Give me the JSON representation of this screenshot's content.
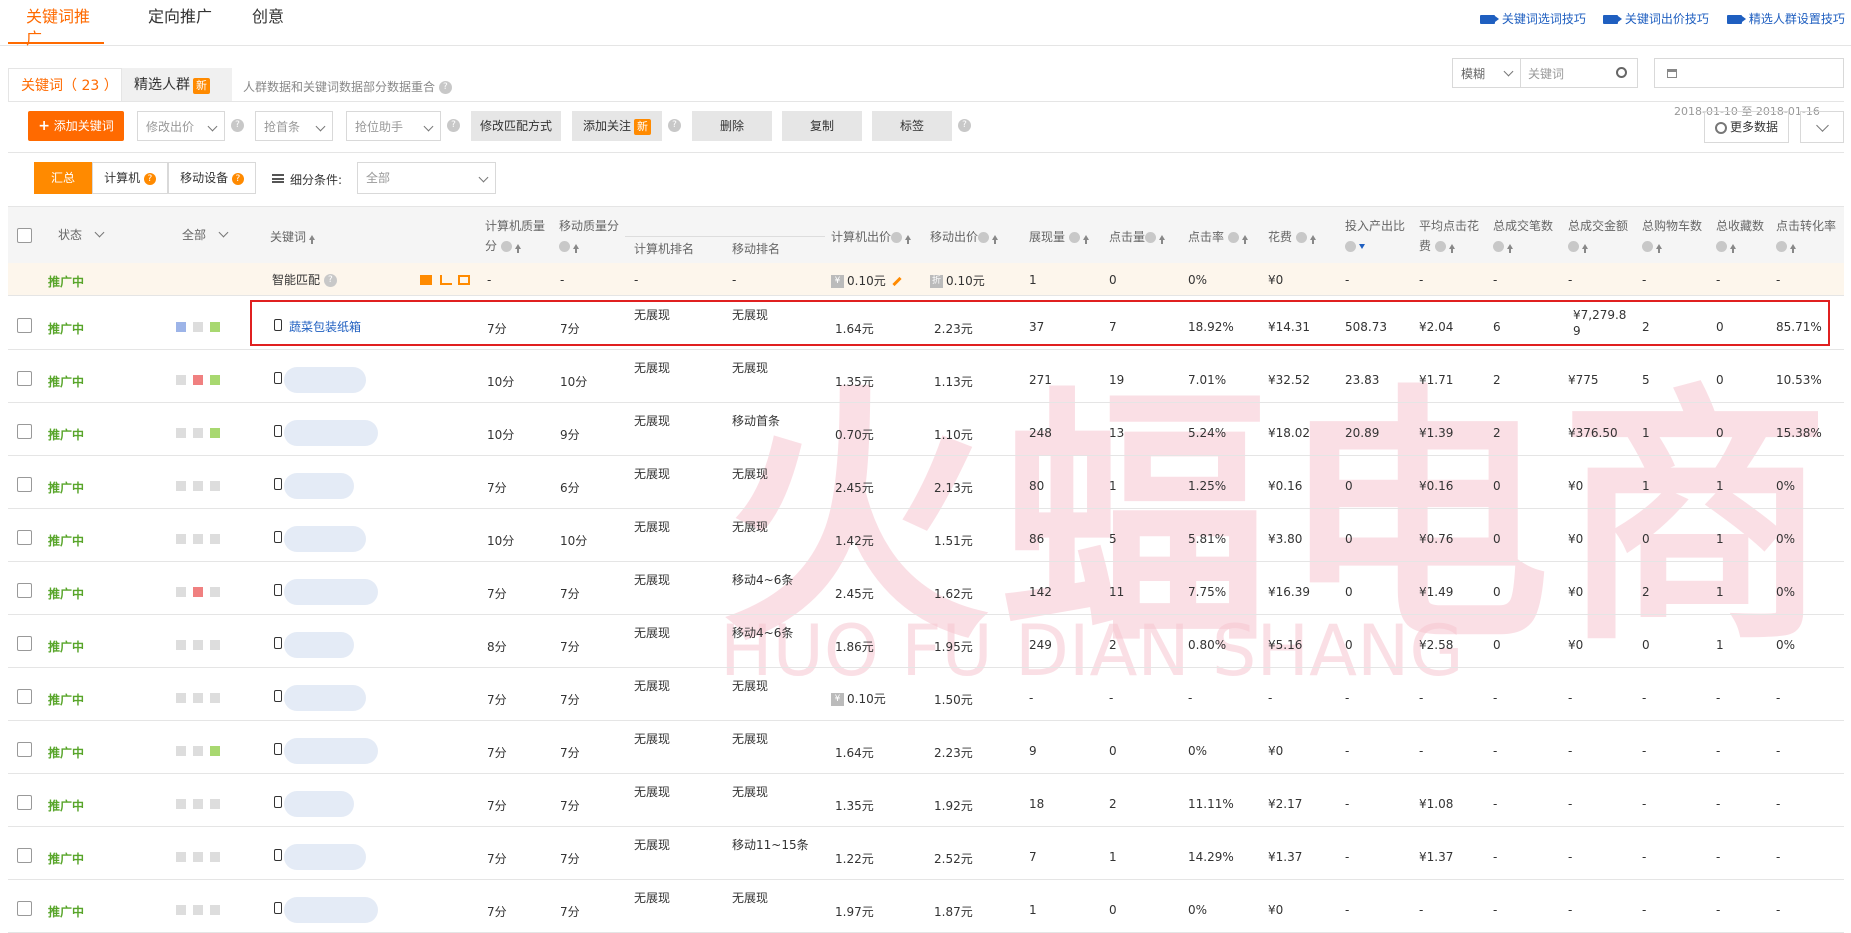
{
  "nav": {
    "tabs": [
      "关键词推广",
      "定向推广",
      "创意"
    ]
  },
  "tips": [
    "关键词选词技巧",
    "关键词出价技巧",
    "精选人群设置技巧"
  ],
  "subtabs": {
    "keyword": "关键词（ 23 ）",
    "crowd": "精选人群",
    "new": "新"
  },
  "note": "人群数据和关键词数据部分数据重合",
  "search": {
    "mode": "模糊",
    "placeholder": "关键词"
  },
  "date": "2018-01-10 至 2018-01-16",
  "toolbar": {
    "add": "添加关键词",
    "modify_bid": "修改出价",
    "first_bar": "抢首条",
    "rank_helper": "抢位助手",
    "match": "修改匹配方式",
    "follow": "添加关注",
    "new": "新",
    "delete": "删除",
    "copy": "复制",
    "tag": "标签",
    "more": "更多数据"
  },
  "filter": {
    "summary": "汇总",
    "pc": "计算机",
    "mobile": "移动设备",
    "sub": "细分条件:",
    "all": "全部"
  },
  "headers": {
    "status": "状态",
    "all": "全部",
    "keyword": "关键词",
    "pc_q": "计算机质量分",
    "m_q": "移动质量分",
    "pc_rank": "计算机排名",
    "m_rank": "移动排名",
    "pc_bid": "计算机出价",
    "m_bid": "移动出价",
    "impr": "展现量",
    "clicks": "点击量",
    "ctr": "点击率",
    "cost": "花费",
    "roi": "投入产出比",
    "cpc": "平均点击花费",
    "orders": "总成交笔数",
    "gmv": "总成交金额",
    "cart": "总购物车数",
    "fav": "总收藏数",
    "cvr": "点击转化率"
  },
  "smart_row": {
    "status": "推广中",
    "keyword": "智能匹配",
    "pc_q": "-",
    "m_q": "-",
    "pc_rank": "-",
    "m_rank": "-",
    "pc_bid": "0.10元",
    "m_bid": "0.10元",
    "impr": "1",
    "clicks": "0",
    "ctr": "0%",
    "cost": "¥0",
    "roi": "-",
    "cpc": "-",
    "orders": "-",
    "gmv": "-",
    "cart": "-",
    "fav": "-",
    "cvr": "-"
  },
  "rows": [
    {
      "status": "推广中",
      "keyword": "蔬菜包装纸箱",
      "pc_q": "7分",
      "m_q": "7分",
      "pc_rank": "无展现",
      "m_rank": "无展现",
      "pc_bid": "1.64元",
      "m_bid": "2.23元",
      "impr": "37",
      "clicks": "7",
      "ctr": "18.92%",
      "cost": "¥14.31",
      "roi": "508.73",
      "cpc": "¥2.04",
      "orders": "6",
      "gmv": "¥7,279.8",
      "gmv2": "9",
      "cart": "2",
      "fav": "0",
      "cvr": "85.71%",
      "sq": [
        "#9db4e8",
        "#ddd",
        "#a8d870"
      ]
    },
    {
      "status": "推广中",
      "keyword": "",
      "pc_q": "10分",
      "m_q": "10分",
      "pc_rank": "无展现",
      "m_rank": "无展现",
      "pc_bid": "1.35元",
      "m_bid": "1.13元",
      "impr": "271",
      "clicks": "19",
      "ctr": "7.01%",
      "cost": "¥32.52",
      "roi": "23.83",
      "cpc": "¥1.71",
      "orders": "2",
      "gmv": "¥775",
      "gmv2": "",
      "cart": "5",
      "fav": "0",
      "cvr": "10.53%",
      "sq": [
        "#ddd",
        "#f08080",
        "#a8d870"
      ]
    },
    {
      "status": "推广中",
      "keyword": "",
      "pc_q": "10分",
      "m_q": "9分",
      "pc_rank": "无展现",
      "m_rank": "移动首条",
      "pc_bid": "0.70元",
      "m_bid": "1.10元",
      "impr": "248",
      "clicks": "13",
      "ctr": "5.24%",
      "cost": "¥18.02",
      "roi": "20.89",
      "cpc": "¥1.39",
      "orders": "2",
      "gmv": "¥376.50",
      "gmv2": "",
      "cart": "1",
      "fav": "0",
      "cvr": "15.38%",
      "sq": [
        "#ddd",
        "#ddd",
        "#a8d870"
      ]
    },
    {
      "status": "推广中",
      "keyword": "",
      "pc_q": "7分",
      "m_q": "6分",
      "pc_rank": "无展现",
      "m_rank": "无展现",
      "pc_bid": "2.45元",
      "m_bid": "2.13元",
      "impr": "80",
      "clicks": "1",
      "ctr": "1.25%",
      "cost": "¥0.16",
      "roi": "0",
      "cpc": "¥0.16",
      "orders": "0",
      "gmv": "¥0",
      "gmv2": "",
      "cart": "1",
      "fav": "1",
      "cvr": "0%",
      "sq": [
        "#ddd",
        "#ddd",
        "#ddd"
      ]
    },
    {
      "status": "推广中",
      "keyword": "",
      "pc_q": "10分",
      "m_q": "10分",
      "pc_rank": "无展现",
      "m_rank": "无展现",
      "pc_bid": "1.42元",
      "m_bid": "1.51元",
      "impr": "86",
      "clicks": "5",
      "ctr": "5.81%",
      "cost": "¥3.80",
      "roi": "0",
      "cpc": "¥0.76",
      "orders": "0",
      "gmv": "¥0",
      "gmv2": "",
      "cart": "0",
      "fav": "1",
      "cvr": "0%",
      "sq": [
        "#ddd",
        "#ddd",
        "#ddd"
      ]
    },
    {
      "status": "推广中",
      "keyword": "",
      "pc_q": "7分",
      "m_q": "7分",
      "pc_rank": "无展现",
      "m_rank": "移动4~6条",
      "pc_bid": "2.45元",
      "m_bid": "1.62元",
      "impr": "142",
      "clicks": "11",
      "ctr": "7.75%",
      "cost": "¥16.39",
      "roi": "0",
      "cpc": "¥1.49",
      "orders": "0",
      "gmv": "¥0",
      "gmv2": "",
      "cart": "2",
      "fav": "1",
      "cvr": "0%",
      "sq": [
        "#ddd",
        "#f08080",
        "#ddd"
      ]
    },
    {
      "status": "推广中",
      "keyword": "",
      "pc_q": "8分",
      "m_q": "7分",
      "pc_rank": "无展现",
      "m_rank": "移动4~6条",
      "pc_bid": "1.86元",
      "m_bid": "1.95元",
      "impr": "249",
      "clicks": "2",
      "ctr": "0.80%",
      "cost": "¥5.16",
      "roi": "0",
      "cpc": "¥2.58",
      "orders": "0",
      "gmv": "¥0",
      "gmv2": "",
      "cart": "0",
      "fav": "1",
      "cvr": "0%",
      "sq": [
        "#ddd",
        "#ddd",
        "#ddd"
      ]
    },
    {
      "status": "推广中",
      "keyword": "",
      "pc_q": "7分",
      "m_q": "7分",
      "pc_rank": "无展现",
      "m_rank": "无展现",
      "pc_bid": "0.10元",
      "m_bid": "1.50元",
      "impr": "-",
      "clicks": "-",
      "ctr": "-",
      "cost": "-",
      "roi": "-",
      "cpc": "-",
      "orders": "-",
      "gmv": "-",
      "gmv2": "",
      "cart": "-",
      "fav": "-",
      "cvr": "-",
      "sq": [
        "#ddd",
        "#ddd",
        "#ddd"
      ]
    },
    {
      "status": "推广中",
      "keyword": "",
      "pc_q": "7分",
      "m_q": "7分",
      "pc_rank": "无展现",
      "m_rank": "无展现",
      "pc_bid": "1.64元",
      "m_bid": "2.23元",
      "impr": "9",
      "clicks": "0",
      "ctr": "0%",
      "cost": "¥0",
      "roi": "-",
      "cpc": "-",
      "orders": "-",
      "gmv": "-",
      "gmv2": "",
      "cart": "-",
      "fav": "-",
      "cvr": "-",
      "sq": [
        "#ddd",
        "#ddd",
        "#a8d870"
      ]
    },
    {
      "status": "推广中",
      "keyword": "",
      "pc_q": "7分",
      "m_q": "7分",
      "pc_rank": "无展现",
      "m_rank": "无展现",
      "pc_bid": "1.35元",
      "m_bid": "1.92元",
      "impr": "18",
      "clicks": "2",
      "ctr": "11.11%",
      "cost": "¥2.17",
      "roi": "-",
      "cpc": "¥1.08",
      "orders": "-",
      "gmv": "-",
      "gmv2": "",
      "cart": "-",
      "fav": "-",
      "cvr": "-",
      "sq": [
        "#ddd",
        "#ddd",
        "#ddd"
      ]
    },
    {
      "status": "推广中",
      "keyword": "",
      "pc_q": "7分",
      "m_q": "7分",
      "pc_rank": "无展现",
      "m_rank": "移动11~15条",
      "pc_bid": "1.22元",
      "m_bid": "2.52元",
      "impr": "7",
      "clicks": "1",
      "ctr": "14.29%",
      "cost": "¥1.37",
      "roi": "-",
      "cpc": "¥1.37",
      "orders": "-",
      "gmv": "-",
      "gmv2": "",
      "cart": "-",
      "fav": "-",
      "cvr": "-",
      "sq": [
        "#ddd",
        "#ddd",
        "#ddd"
      ]
    },
    {
      "status": "推广中",
      "keyword": "",
      "pc_q": "7分",
      "m_q": "7分",
      "pc_rank": "无展现",
      "m_rank": "无展现",
      "pc_bid": "1.97元",
      "m_bid": "1.87元",
      "impr": "1",
      "clicks": "0",
      "ctr": "0%",
      "cost": "¥0",
      "roi": "-",
      "cpc": "-",
      "orders": "-",
      "gmv": "-",
      "gmv2": "",
      "cart": "-",
      "fav": "-",
      "cvr": "-",
      "sq": [
        "#ddd",
        "#ddd",
        "#ddd"
      ]
    }
  ],
  "watermark": {
    "cn": "火蝠电商",
    "en": "HUO FU DIAN SHANG"
  }
}
